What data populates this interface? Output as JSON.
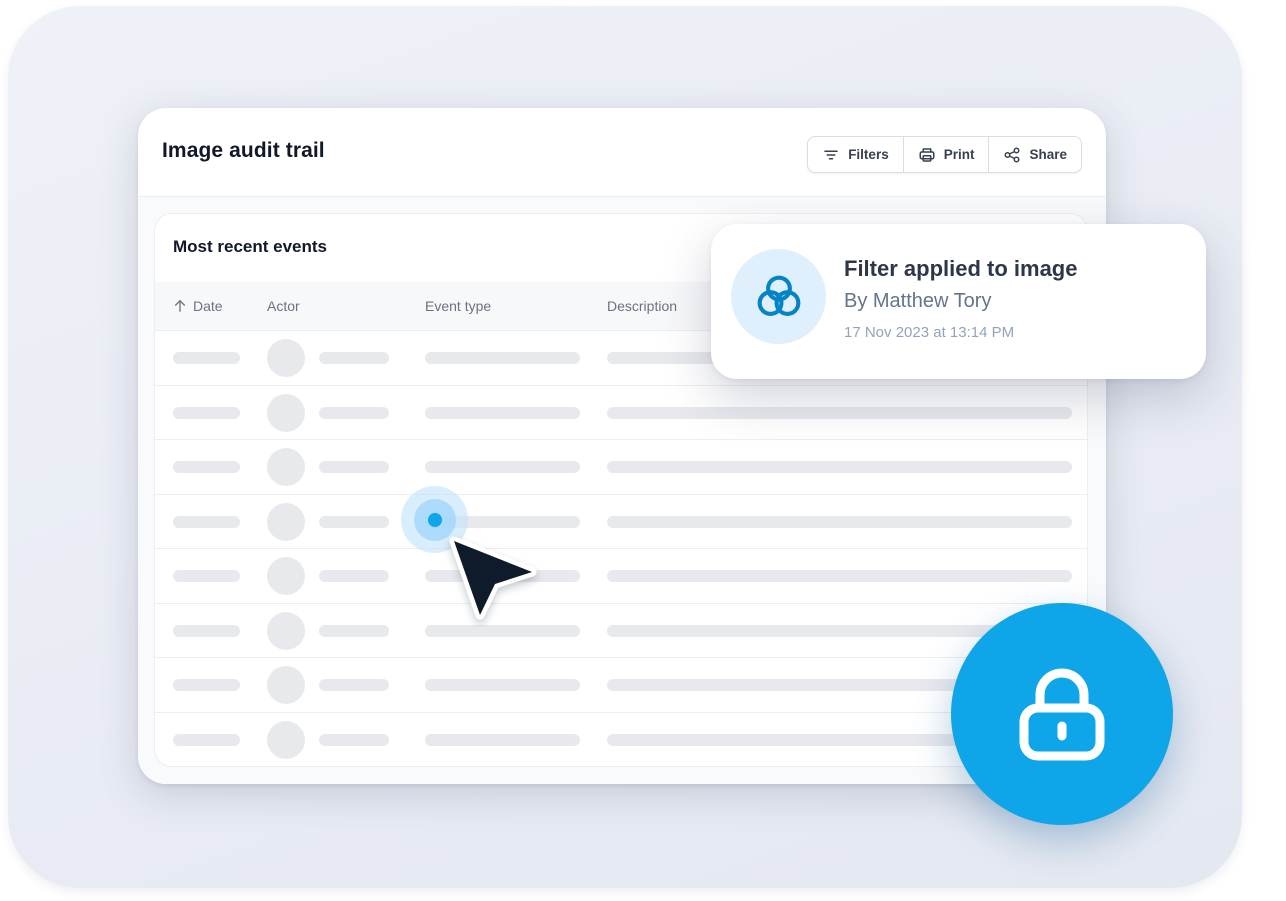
{
  "panel": {
    "title": "Image audit trail",
    "toolbar": {
      "filters_label": "Filters",
      "print_label": "Print",
      "share_label": "Share"
    }
  },
  "events_card": {
    "title": "Most recent events",
    "columns": [
      {
        "label": "Date",
        "sort": "ascending",
        "icon": "arrow-up-icon"
      },
      {
        "label": "Actor"
      },
      {
        "label": "Event type"
      },
      {
        "label": "Description"
      }
    ],
    "skeleton_row_count": 8
  },
  "popover": {
    "icon": "overlapping-circles-filter-icon",
    "title": "Filter applied to image",
    "actor": "By Matthew Tory",
    "timestamp": "17 Nov 2023 at 13:14 PM"
  },
  "badge": {
    "icon": "lock-icon"
  },
  "colors": {
    "accent": "#0ea5e9",
    "accent_light": "#dff0fc",
    "filter_icon": "#0284c7",
    "skeleton": "#e8e9ed",
    "cursor": "#0f1b2a"
  }
}
